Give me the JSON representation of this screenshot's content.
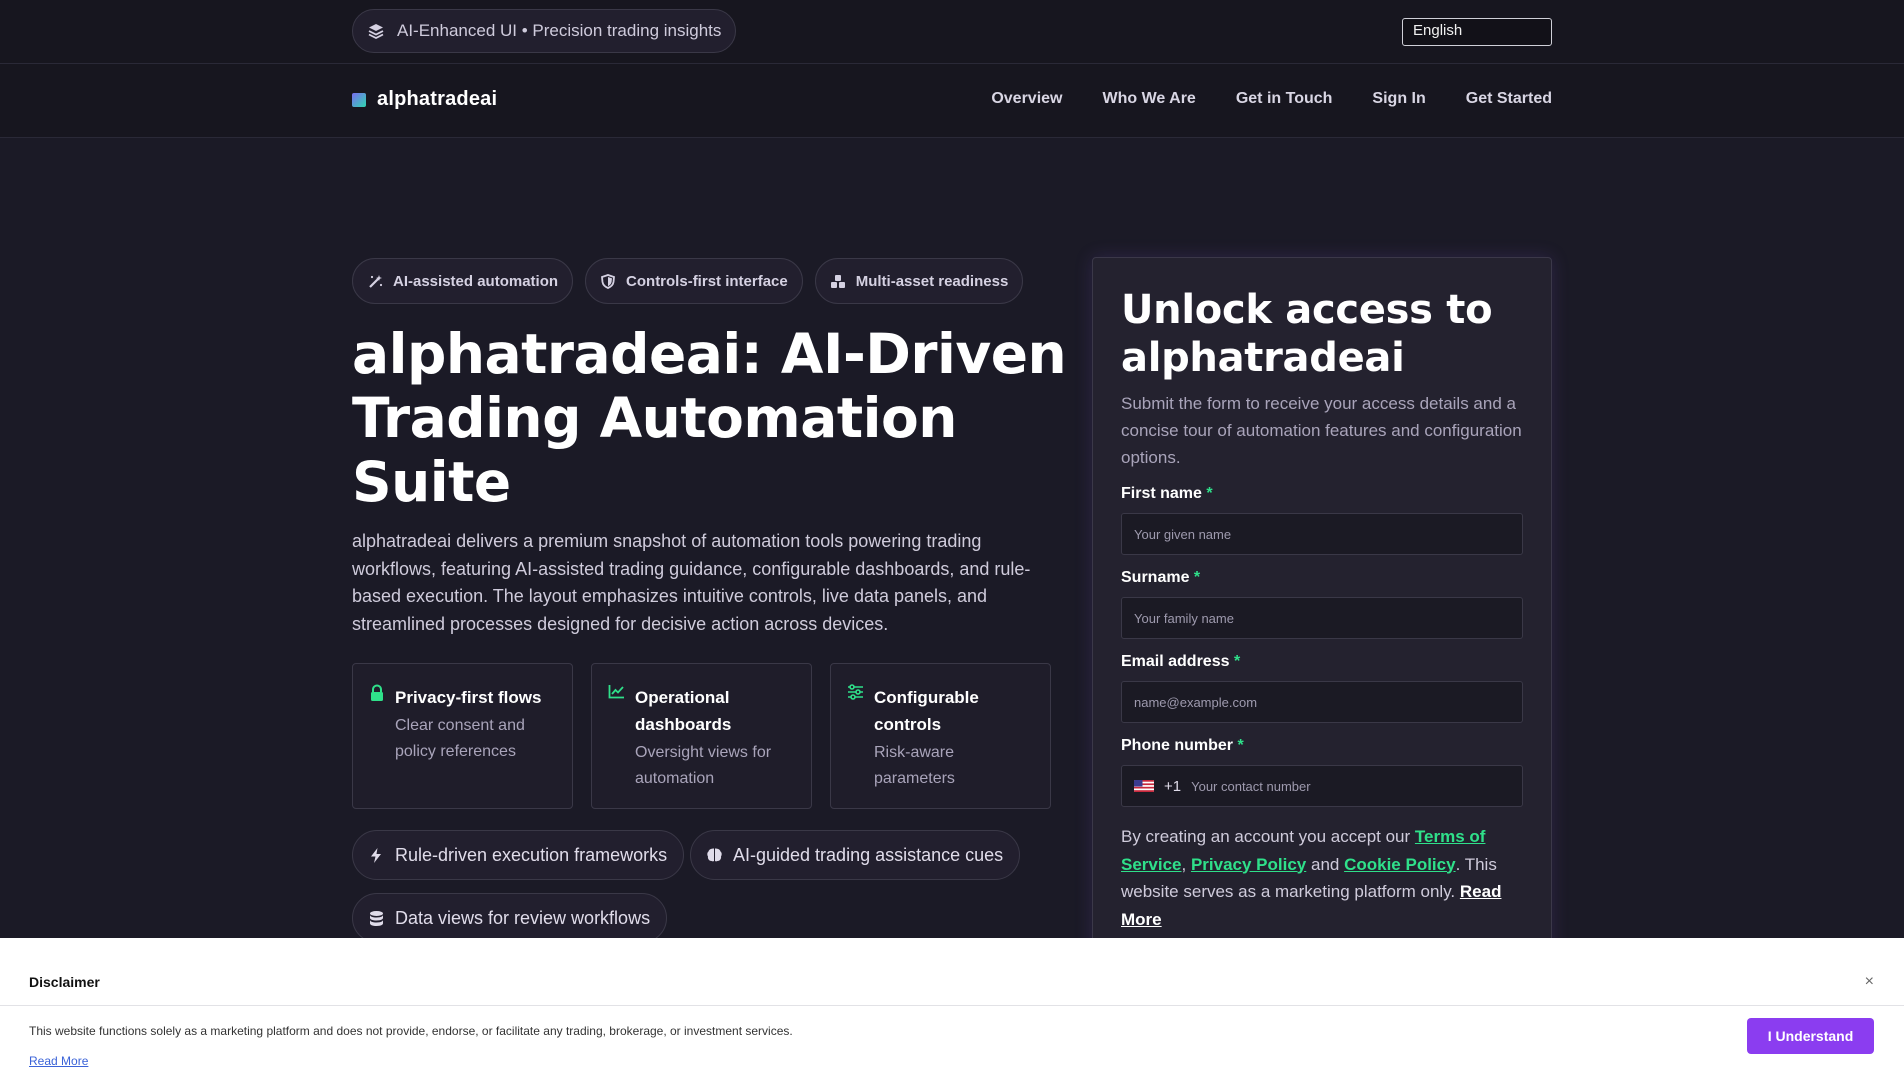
{
  "topbar": {
    "badge_text": "AI-Enhanced UI • Precision trading insights",
    "badge_icon": "layers-icon",
    "language": "English"
  },
  "nav": {
    "brand": "alphatradeai",
    "links": [
      "Overview",
      "Who We Are",
      "Get in Touch",
      "Sign In",
      "Get Started"
    ]
  },
  "hero": {
    "tags": [
      {
        "label": "AI-assisted automation",
        "icon": "magic-wand-icon"
      },
      {
        "label": "Controls-first interface",
        "icon": "shield-icon"
      },
      {
        "label": "Multi-asset readiness",
        "icon": "cubes-icon"
      }
    ],
    "title": "alphatradeai: AI-Driven Trading Automation Suite",
    "description": "alphatradeai delivers a premium snapshot of automation tools powering trading workflows, featuring AI-assisted trading guidance, configurable dashboards, and rule-based execution. The layout emphasizes intuitive controls, live data panels, and streamlined processes designed for decisive action across devices.",
    "cards": [
      {
        "title": "Privacy-first flows",
        "desc": "Clear consent and policy references",
        "icon": "lock-icon"
      },
      {
        "title": "Operational dashboards",
        "desc": "Oversight views for automation",
        "icon": "chart-line-icon"
      },
      {
        "title": "Configurable controls",
        "desc": "Risk-aware parameters",
        "icon": "sliders-icon"
      }
    ],
    "chips": [
      {
        "label": "Rule-driven execution frameworks",
        "icon": "bolt-icon"
      },
      {
        "label": "AI-guided trading assistance cues",
        "icon": "brain-icon"
      },
      {
        "label": "Data views for review workflows",
        "icon": "database-icon"
      }
    ]
  },
  "form": {
    "title": "Unlock access to alphatradeai",
    "subtitle": "Submit the form to receive your access details and a concise tour of automation features and configuration options.",
    "fields": [
      {
        "label": "First name",
        "placeholder": "Your given name"
      },
      {
        "label": "Surname",
        "placeholder": "Your family name"
      },
      {
        "label": "Email address",
        "placeholder": "name@example.com"
      },
      {
        "label": "Phone number",
        "placeholder": "Your contact number"
      }
    ],
    "required_mark": "*",
    "phone_code": "+1",
    "terms_prefix": "By creating an account you accept our ",
    "terms_link": "Terms of Service",
    "comma": ", ",
    "privacy_link": "Privacy Policy",
    "and": " and ",
    "cookie_link": "Cookie Policy",
    "terms_suffix": ". This website serves as a marketing platform only. ",
    "read_more": "Read More"
  },
  "disclaimer": {
    "title": "Disclaimer",
    "close": "×",
    "text": "This website functions solely as a marketing platform and does not provide, endorse, or facilitate any trading, brokerage, or investment services.",
    "read_more": "Read More",
    "button": "I Understand"
  },
  "colors": {
    "background": "#1b1a26",
    "accent_green": "#2fe08a",
    "accent_purple": "#8b3df0"
  }
}
